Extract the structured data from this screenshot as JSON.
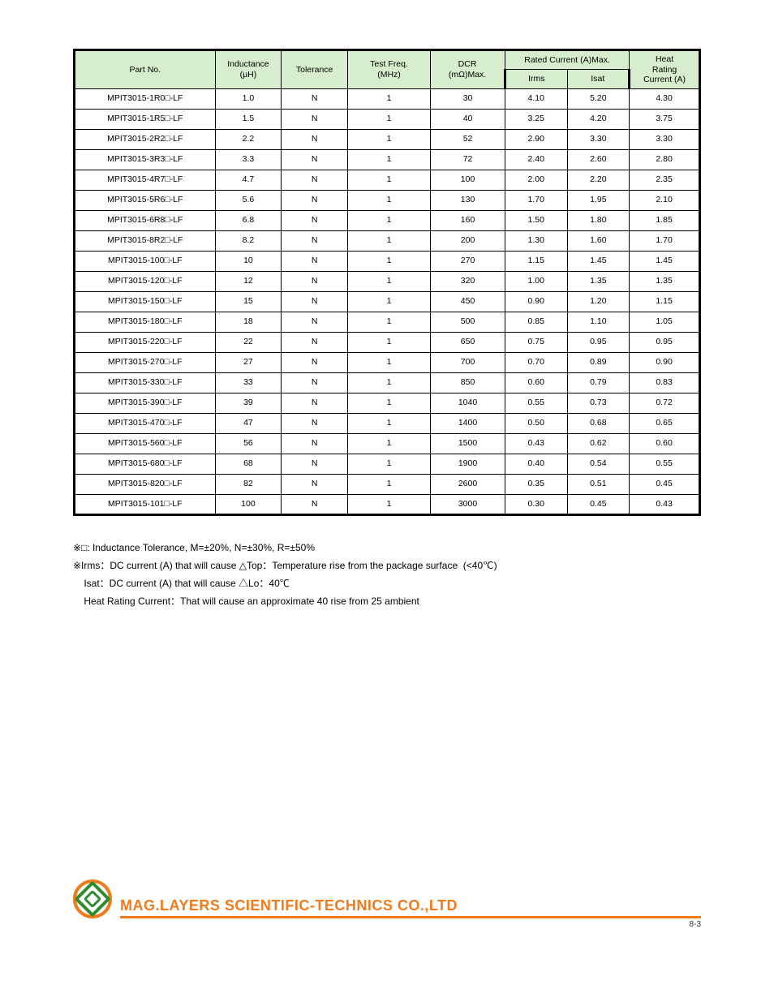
{
  "header": {
    "part_no": "Part No.",
    "inductance": "Inductance\n(μH)",
    "tolerance": "Tolerance",
    "test_freq": "Test Freq.\n(MHz)",
    "dcr": "DCR\n(mΩ)Max.",
    "rated_current": "Rated Current (A)Max.",
    "irms": "Irms",
    "isat": "Isat",
    "heat_rating": "Heat\nRating\nCurrent (A)"
  },
  "rows": [
    {
      "pn": "MPIT3015-1R0□-LF",
      "l": "1.0",
      "tol": "N",
      "f": "1",
      "dcr": "30",
      "irms": "4.10",
      "isat": "5.20",
      "heat": "4.30"
    },
    {
      "pn": "MPIT3015-1R5□-LF",
      "l": "1.5",
      "tol": "N",
      "f": "1",
      "dcr": "40",
      "irms": "3.25",
      "isat": "4.20",
      "heat": "3.75"
    },
    {
      "pn": "MPIT3015-2R2□-LF",
      "l": "2.2",
      "tol": "N",
      "f": "1",
      "dcr": "52",
      "irms": "2.90",
      "isat": "3.30",
      "heat": "3.30"
    },
    {
      "pn": "MPIT3015-3R3□-LF",
      "l": "3.3",
      "tol": "N",
      "f": "1",
      "dcr": "72",
      "irms": "2.40",
      "isat": "2.60",
      "heat": "2.80"
    },
    {
      "pn": "MPIT3015-4R7□-LF",
      "l": "4.7",
      "tol": "N",
      "f": "1",
      "dcr": "100",
      "irms": "2.00",
      "isat": "2.20",
      "heat": "2.35"
    },
    {
      "pn": "MPIT3015-5R6□-LF",
      "l": "5.6",
      "tol": "N",
      "f": "1",
      "dcr": "130",
      "irms": "1.70",
      "isat": "1.95",
      "heat": "2.10"
    },
    {
      "pn": "MPIT3015-6R8□-LF",
      "l": "6.8",
      "tol": "N",
      "f": "1",
      "dcr": "160",
      "irms": "1.50",
      "isat": "1.80",
      "heat": "1.85"
    },
    {
      "pn": "MPIT3015-8R2□-LF",
      "l": "8.2",
      "tol": "N",
      "f": "1",
      "dcr": "200",
      "irms": "1.30",
      "isat": "1.60",
      "heat": "1.70"
    },
    {
      "pn": "MPIT3015-100□-LF",
      "l": "10",
      "tol": "N",
      "f": "1",
      "dcr": "270",
      "irms": "1.15",
      "isat": "1.45",
      "heat": "1.45"
    },
    {
      "pn": "MPIT3015-120□-LF",
      "l": "12",
      "tol": "N",
      "f": "1",
      "dcr": "320",
      "irms": "1.00",
      "isat": "1.35",
      "heat": "1.35"
    },
    {
      "pn": "MPIT3015-150□-LF",
      "l": "15",
      "tol": "N",
      "f": "1",
      "dcr": "450",
      "irms": "0.90",
      "isat": "1.20",
      "heat": "1.15"
    },
    {
      "pn": "MPIT3015-180□-LF",
      "l": "18",
      "tol": "N",
      "f": "1",
      "dcr": "500",
      "irms": "0.85",
      "isat": "1.10",
      "heat": "1.05"
    },
    {
      "pn": "MPIT3015-220□-LF",
      "l": "22",
      "tol": "N",
      "f": "1",
      "dcr": "650",
      "irms": "0.75",
      "isat": "0.95",
      "heat": "0.95"
    },
    {
      "pn": "MPIT3015-270□-LF",
      "l": "27",
      "tol": "N",
      "f": "1",
      "dcr": "700",
      "irms": "0.70",
      "isat": "0.89",
      "heat": "0.90"
    },
    {
      "pn": "MPIT3015-330□-LF",
      "l": "33",
      "tol": "N",
      "f": "1",
      "dcr": "850",
      "irms": "0.60",
      "isat": "0.79",
      "heat": "0.83"
    },
    {
      "pn": "MPIT3015-390□-LF",
      "l": "39",
      "tol": "N",
      "f": "1",
      "dcr": "1040",
      "irms": "0.55",
      "isat": "0.73",
      "heat": "0.72"
    },
    {
      "pn": "MPIT3015-470□-LF",
      "l": "47",
      "tol": "N",
      "f": "1",
      "dcr": "1400",
      "irms": "0.50",
      "isat": "0.68",
      "heat": "0.65"
    },
    {
      "pn": "MPIT3015-560□-LF",
      "l": "56",
      "tol": "N",
      "f": "1",
      "dcr": "1500",
      "irms": "0.43",
      "isat": "0.62",
      "heat": "0.60"
    },
    {
      "pn": "MPIT3015-680□-LF",
      "l": "68",
      "tol": "N",
      "f": "1",
      "dcr": "1900",
      "irms": "0.40",
      "isat": "0.54",
      "heat": "0.55"
    },
    {
      "pn": "MPIT3015-820□-LF",
      "l": "82",
      "tol": "N",
      "f": "1",
      "dcr": "2600",
      "irms": "0.35",
      "isat": "0.51",
      "heat": "0.45"
    },
    {
      "pn": "MPIT3015-101□-LF",
      "l": "100",
      "tol": "N",
      "f": "1",
      "dcr": "3000",
      "irms": "0.30",
      "isat": "0.45",
      "heat": "0.43"
    }
  ],
  "notes": {
    "l1": "※□: Inductance Tolerance, M=±20%, N=±30%, R=±50%",
    "l2": "※Irms：DC current (A) that will cause △Top：Temperature rise from the package surface  (<40℃)",
    "l3": "    Isat：DC current (A) that will cause △Lo：40℃",
    "l4": "    Heat Rating Current：That will cause an approximate 40 rise from 25 ambient"
  },
  "footer": {
    "company": "MAG.LAYERS SCIENTIFIC-TECHNICS CO.,LTD",
    "page": "8-3"
  }
}
